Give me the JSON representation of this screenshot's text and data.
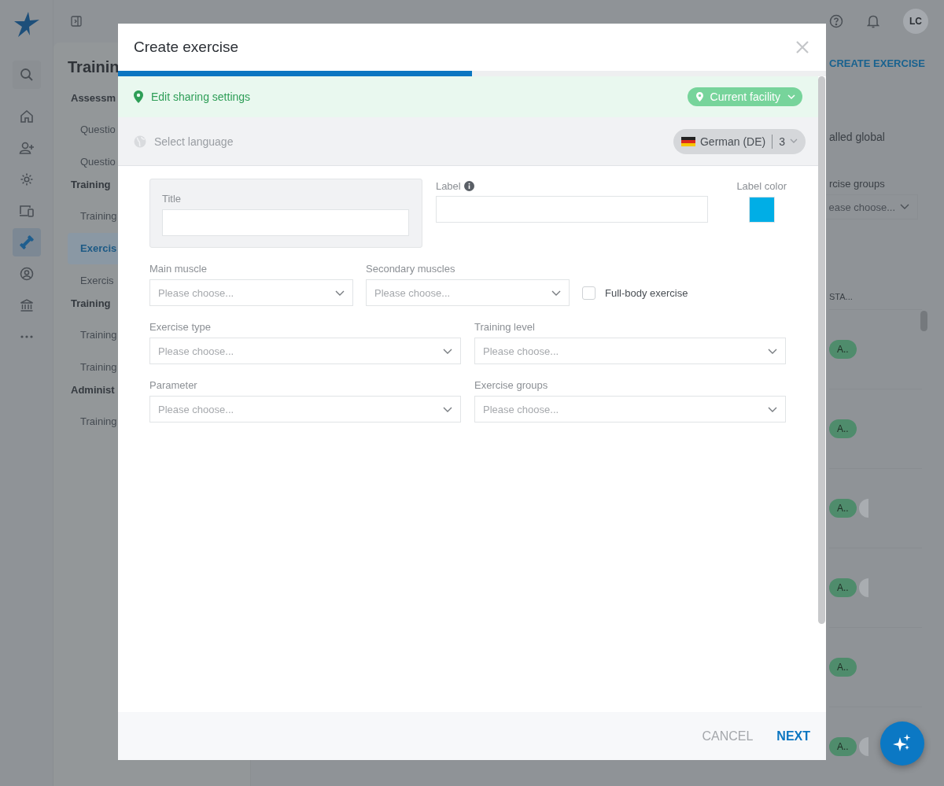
{
  "app": {
    "rail": [
      {
        "kind": "home",
        "selected": false
      },
      {
        "kind": "user-add",
        "selected": false
      },
      {
        "kind": "gear",
        "selected": false
      },
      {
        "kind": "devices",
        "selected": false
      },
      {
        "kind": "dumbbell",
        "selected": true
      },
      {
        "kind": "user-circle",
        "selected": false
      },
      {
        "kind": "bank",
        "selected": false
      },
      {
        "kind": "more",
        "selected": false
      }
    ],
    "avatar": "LC",
    "sidebar": {
      "heading": "Trainin",
      "groups": [
        {
          "title": "Assessm",
          "items": [
            {
              "label": "Questio",
              "selected": false
            },
            {
              "label": "Questio",
              "selected": false
            }
          ]
        },
        {
          "title": "Training",
          "items": [
            {
              "label": "Training",
              "selected": false
            },
            {
              "label": "Exercis",
              "selected": true
            },
            {
              "label": "Exercis",
              "selected": false
            }
          ]
        },
        {
          "title": "Training",
          "items": [
            {
              "label": "Training",
              "selected": false
            },
            {
              "label": "Training",
              "selected": false
            }
          ]
        },
        {
          "title": "Administ",
          "items": [
            {
              "label": "Training",
              "selected": false
            }
          ]
        }
      ]
    },
    "page": {
      "action": "CREATE EXERCISE",
      "note": "alled global",
      "filter_label": "rcise groups",
      "filter_placeholder": "ease choose...",
      "column": "STA...",
      "rows": [
        {
          "badge": "A..",
          "extra_badge": false
        },
        {
          "badge": "A..",
          "extra_badge": false
        },
        {
          "badge": "A..",
          "extra_badge": true
        },
        {
          "badge": "A..",
          "extra_badge": true
        },
        {
          "badge": "A..",
          "extra_badge": false
        },
        {
          "badge": "A..",
          "extra_badge": true
        }
      ]
    }
  },
  "dialog": {
    "title": "Create exercise",
    "progress": {
      "level": 0.5
    },
    "sharing": {
      "label": "Edit sharing settings",
      "scope": "Current facility"
    },
    "language": {
      "label": "Select language",
      "current": "German (DE)",
      "count": "3"
    },
    "title_field": {
      "label": "Title"
    },
    "label_field": {
      "label": "Label"
    },
    "label_color": {
      "label": "Label color",
      "color": "#00aee6"
    },
    "muscle_fields": [
      {
        "label": "Main muscle",
        "placeholder": "Please choose..."
      },
      {
        "label": "Secondary muscles",
        "placeholder": "Please choose..."
      }
    ],
    "full_body": {
      "label": "Full-body exercise",
      "checked": false
    },
    "fields": [
      {
        "label": "Exercise type",
        "placeholder": "Please choose..."
      },
      {
        "label": "Training level",
        "placeholder": "Please choose..."
      },
      {
        "label": "Parameter",
        "placeholder": "Please choose..."
      },
      {
        "label": "Exercise groups",
        "placeholder": "Please choose..."
      }
    ],
    "buttons": [
      {
        "label": "CANCEL",
        "kind": "secondary"
      },
      {
        "label": "NEXT",
        "kind": "primary"
      }
    ]
  }
}
